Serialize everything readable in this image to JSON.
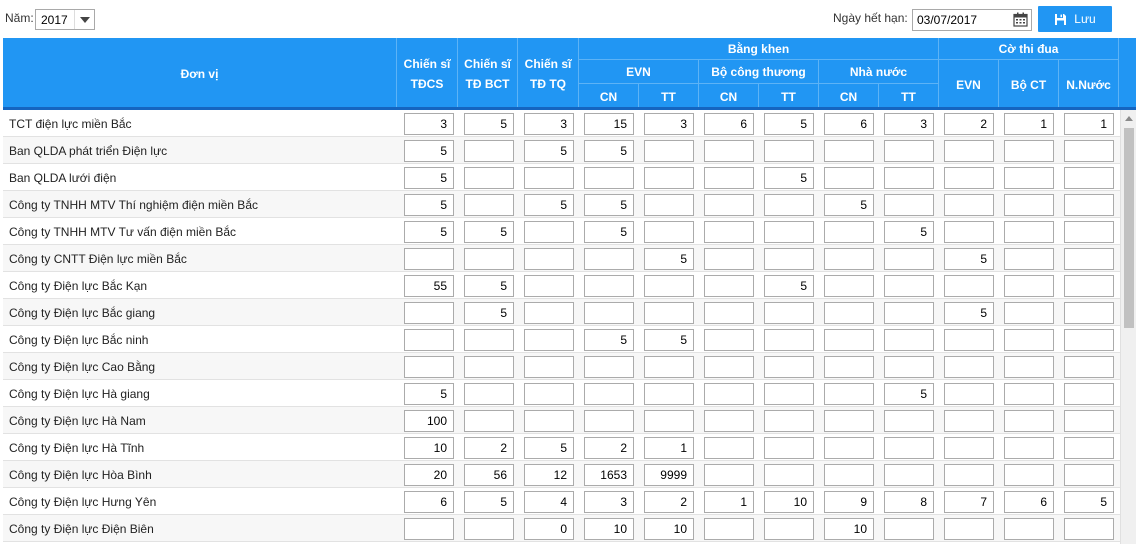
{
  "toolbar": {
    "year_label": "Năm:",
    "year_value": "2017",
    "expiry_label": "Ngày hết hạn:",
    "expiry_date": "03/07/2017",
    "save_label": "Lưu"
  },
  "header": {
    "unit": "Đơn vị",
    "tdcs_1": "Chiến sĩ",
    "tdcs_2": "TĐCS",
    "tdbct_1": "Chiến sĩ",
    "tdbct_2": "TĐ BCT",
    "tdtq_1": "Chiến sĩ",
    "tdtq_2": "TĐ TQ",
    "bang_khen": "Bằng khen",
    "evn": "EVN",
    "bo_cong_thuong": "Bộ công thương",
    "nha_nuoc": "Nhà nước",
    "co_thi_dua": "Cờ thi đua",
    "cn": "CN",
    "tt": "TT",
    "co_evn": "EVN",
    "co_boct": "Bộ CT",
    "co_nnuoc": "N.Nước"
  },
  "rows": [
    {
      "name": "TCT điện lực miền Bắc",
      "v": [
        "3",
        "5",
        "3",
        "15",
        "3",
        "6",
        "5",
        "6",
        "3",
        "2",
        "1",
        "1"
      ]
    },
    {
      "name": "Ban QLDA phát triển Điện lực",
      "v": [
        "5",
        "",
        "5",
        "5",
        "",
        "",
        "",
        "",
        "",
        "",
        "",
        ""
      ]
    },
    {
      "name": "Ban QLDA lưới điện",
      "v": [
        "5",
        "",
        "",
        "",
        "",
        "",
        "5",
        "",
        "",
        "",
        "",
        ""
      ]
    },
    {
      "name": "Công ty TNHH MTV Thí nghiệm điện miền Bắc",
      "v": [
        "5",
        "",
        "5",
        "5",
        "",
        "",
        "",
        "5",
        "",
        "",
        "",
        ""
      ]
    },
    {
      "name": "Công ty TNHH MTV Tư vấn điện miền Bắc",
      "v": [
        "5",
        "5",
        "",
        "5",
        "",
        "",
        "",
        "",
        "5",
        "",
        "",
        ""
      ]
    },
    {
      "name": "Công ty CNTT Điện lực miền Bắc",
      "v": [
        "",
        "",
        "",
        "",
        "5",
        "",
        "",
        "",
        "",
        "5",
        "",
        ""
      ]
    },
    {
      "name": "Công ty Điện lực Bắc Kạn",
      "v": [
        "55",
        "5",
        "",
        "",
        "",
        "",
        "5",
        "",
        "",
        "",
        "",
        ""
      ]
    },
    {
      "name": "Công ty Điện lực Bắc giang",
      "v": [
        "",
        "5",
        "",
        "",
        "",
        "",
        "",
        "",
        "",
        "5",
        "",
        ""
      ]
    },
    {
      "name": "Công ty Điện lực Bắc ninh",
      "v": [
        "",
        "",
        "",
        "5",
        "5",
        "",
        "",
        "",
        "",
        "",
        "",
        ""
      ]
    },
    {
      "name": "Công ty Điện lực Cao Bằng",
      "v": [
        "",
        "",
        "",
        "",
        "",
        "",
        "",
        "",
        "",
        "",
        "",
        ""
      ]
    },
    {
      "name": "Công ty Điện lực Hà giang",
      "v": [
        "5",
        "",
        "",
        "",
        "",
        "",
        "",
        "",
        "5",
        "",
        "",
        ""
      ]
    },
    {
      "name": "Công ty Điện lực Hà Nam",
      "v": [
        "100",
        "",
        "",
        "",
        "",
        "",
        "",
        "",
        "",
        "",
        "",
        ""
      ]
    },
    {
      "name": "Công ty Điện lực Hà Tĩnh",
      "v": [
        "10",
        "2",
        "5",
        "2",
        "1",
        "",
        "",
        "",
        "",
        "",
        "",
        ""
      ]
    },
    {
      "name": "Công ty Điện lực Hòa Bình",
      "v": [
        "20",
        "56",
        "12",
        "1653",
        "9999",
        "",
        "",
        "",
        "",
        "",
        "",
        ""
      ]
    },
    {
      "name": "Công ty Điện lực Hưng Yên",
      "v": [
        "6",
        "5",
        "4",
        "3",
        "2",
        "1",
        "10",
        "9",
        "8",
        "7",
        "6",
        "5"
      ]
    },
    {
      "name": "Công ty Điện lực Điện Biên",
      "v": [
        "",
        "",
        "0",
        "10",
        "10",
        "",
        "",
        "10",
        "",
        "",
        "",
        ""
      ]
    }
  ]
}
